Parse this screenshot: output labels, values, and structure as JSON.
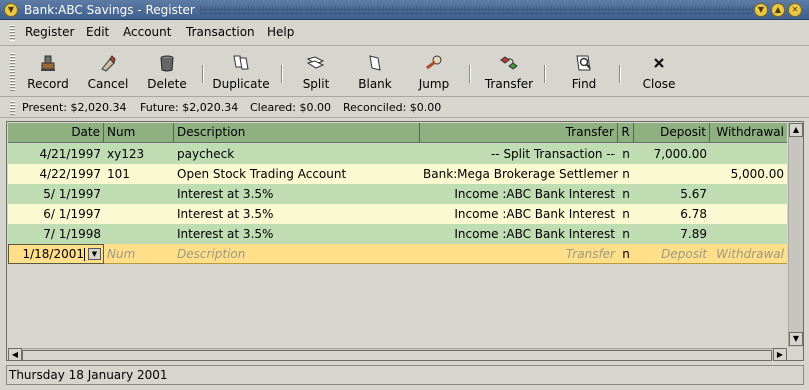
{
  "window": {
    "title": "Bank:ABC Savings - Register"
  },
  "menu": [
    "Register",
    "Edit",
    "Account",
    "Transaction",
    "Help"
  ],
  "toolbar": [
    {
      "label": "Record",
      "icon": "record-icon"
    },
    {
      "label": "Cancel",
      "icon": "cancel-icon"
    },
    {
      "label": "Delete",
      "icon": "delete-icon"
    },
    {
      "label": "Duplicate",
      "icon": "duplicate-icon"
    },
    {
      "label": "Split",
      "icon": "split-icon"
    },
    {
      "label": "Blank",
      "icon": "blank-icon"
    },
    {
      "label": "Jump",
      "icon": "jump-icon"
    },
    {
      "label": "Transfer",
      "icon": "transfer-icon"
    },
    {
      "label": "Find",
      "icon": "find-icon"
    },
    {
      "label": "Close",
      "icon": "close-icon"
    }
  ],
  "summary": {
    "present": "Present: $2,020.34",
    "future": "Future: $2,020.34",
    "cleared": "Cleared: $0.00",
    "reconciled": "Reconciled: $0.00"
  },
  "register": {
    "headers": {
      "date": "Date",
      "num": "Num",
      "description": "Description",
      "transfer": "Transfer",
      "r": "R",
      "deposit": "Deposit",
      "withdrawal": "Withdrawal"
    },
    "rows": [
      {
        "date": "4/21/1997",
        "num": "xy123",
        "description": "paycheck",
        "transfer": "-- Split Transaction --",
        "r": "n",
        "deposit": "7,000.00",
        "withdrawal": ""
      },
      {
        "date": "4/22/1997",
        "num": "101",
        "description": "Open Stock Trading Account",
        "transfer": "Bank:Mega Brokerage Settlement",
        "r": "n",
        "deposit": "",
        "withdrawal": "5,000.00"
      },
      {
        "date": "5/ 1/1997",
        "num": "",
        "description": "Interest at 3.5%",
        "transfer": "Income :ABC Bank Interest",
        "r": "n",
        "deposit": "5.67",
        "withdrawal": ""
      },
      {
        "date": "6/ 1/1997",
        "num": "",
        "description": "Interest at 3.5%",
        "transfer": "Income :ABC Bank Interest",
        "r": "n",
        "deposit": "6.78",
        "withdrawal": ""
      },
      {
        "date": "7/ 1/1998",
        "num": "",
        "description": "Interest at 3.5%",
        "transfer": "Income :ABC Bank Interest",
        "r": "n",
        "deposit": "7.89",
        "withdrawal": ""
      }
    ],
    "entry": {
      "date": "1/18/2001",
      "num": "Num",
      "description": "Description",
      "transfer": "Transfer",
      "r": "n",
      "deposit": "Deposit",
      "withdrawal": "Withdrawal"
    }
  },
  "colors": {
    "header": "#8fb080",
    "row_green": "#bfdcb2",
    "row_yellow": "#fafad2",
    "entry_row": "#ffdf8a"
  },
  "status": "Thursday 18 January 2001"
}
